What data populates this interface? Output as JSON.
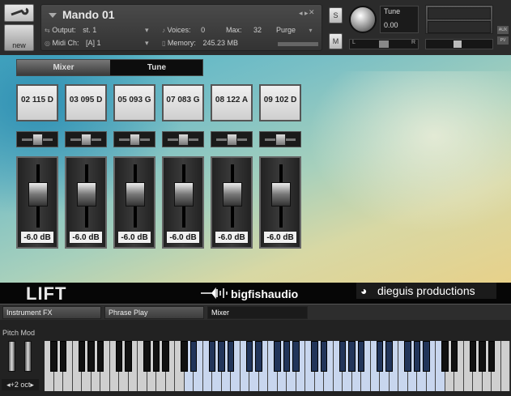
{
  "instrument": {
    "name": "Mando 01",
    "output_label": "Output:",
    "output_value": "st. 1",
    "voices_label": "Voices:",
    "voices_value": "0",
    "max_label": "Max:",
    "max_value": "32",
    "purge_label": "Purge",
    "midi_label": "Midi Ch:",
    "midi_value": "[A]  1",
    "memory_label": "Memory:",
    "memory_value": "245.23 MB",
    "s_label": "S",
    "m_label": "M",
    "tune_label": "Tune",
    "tune_value": "0.00",
    "pan_left": "L",
    "pan_right": "R",
    "aux_label": "AUX",
    "pv_label": "PV",
    "new_label": "new"
  },
  "mixer_tabs": [
    {
      "label": "Mixer",
      "active": true
    },
    {
      "label": "Tune",
      "active": false
    }
  ],
  "channels": [
    {
      "label": "02 115 D",
      "db": "-6.0 dB"
    },
    {
      "label": "03 095 D",
      "db": "-6.0 dB"
    },
    {
      "label": "05 093 G",
      "db": "-6.0 dB"
    },
    {
      "label": "07 083 G",
      "db": "-6.0 dB"
    },
    {
      "label": "08 122 A",
      "db": "-6.0 dB"
    },
    {
      "label": "09 102 D",
      "db": "-6.0 dB"
    }
  ],
  "footer": {
    "brand1": "LIFT",
    "brand2": "bigfishaudio",
    "brand3": "dieguis productions"
  },
  "script_tabs": [
    {
      "label": "Instrument FX"
    },
    {
      "label": "Phrase Play"
    },
    {
      "label": "Mixer",
      "active": true
    }
  ],
  "keyboard": {
    "label": "Pitch Mod",
    "octave": "◂+2 oct▸"
  },
  "colors": {
    "accent_key_lit": "#c8d6ee",
    "panel_bg": "#2b2b2b"
  }
}
